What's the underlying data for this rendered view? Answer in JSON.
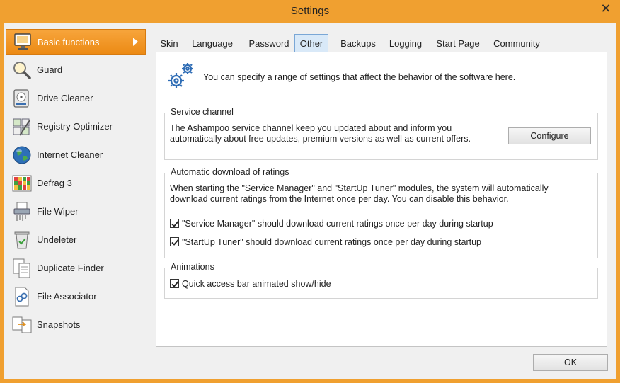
{
  "window": {
    "title": "Settings",
    "close_icon": "close-icon"
  },
  "sidebar": {
    "items": [
      {
        "label": "Basic functions",
        "icon": "monitor-settings-icon",
        "active": true
      },
      {
        "label": "Guard",
        "icon": "magnifier-icon"
      },
      {
        "label": "Drive Cleaner",
        "icon": "drive-cleaner-icon"
      },
      {
        "label": "Registry Optimizer",
        "icon": "registry-icon"
      },
      {
        "label": "Internet Cleaner",
        "icon": "globe-icon"
      },
      {
        "label": "Defrag 3",
        "icon": "defrag-grid-icon"
      },
      {
        "label": "File Wiper",
        "icon": "shredder-icon"
      },
      {
        "label": "Undeleter",
        "icon": "recycle-bin-icon"
      },
      {
        "label": "Duplicate Finder",
        "icon": "duplicate-docs-icon"
      },
      {
        "label": "File Associator",
        "icon": "file-link-icon"
      },
      {
        "label": "Snapshots",
        "icon": "snapshots-icon"
      }
    ]
  },
  "tabs": [
    {
      "label": "Skin"
    },
    {
      "label": "Language"
    },
    {
      "label": "Password"
    },
    {
      "label": "Other",
      "active": true
    },
    {
      "label": "Backups"
    },
    {
      "label": "Logging"
    },
    {
      "label": "Start Page"
    },
    {
      "label": "Community"
    }
  ],
  "intro": {
    "text": "You can specify a range of settings that affect the behavior of the software here.",
    "icon": "gears-icon"
  },
  "service_channel": {
    "title": "Service channel",
    "line1": "The Ashampoo service channel keep you updated about and inform you",
    "line2": "automatically about free updates, premium versions as well as current offers.",
    "button": "Configure"
  },
  "ratings": {
    "title": "Automatic download of ratings",
    "line1": "When starting the \"Service Manager\" and \"StartUp Tuner\" modules, the system will automatically",
    "line2": "download current ratings from the Internet once per day. You can disable this behavior.",
    "checks": [
      {
        "label": "\"Service Manager\" should download current ratings once per day during startup",
        "checked": true
      },
      {
        "label": "\"StartUp Tuner\" should download current ratings once per day during startup",
        "checked": true
      }
    ]
  },
  "animations": {
    "title": "Animations",
    "checks": [
      {
        "label": "Quick access bar animated show/hide",
        "checked": true
      }
    ]
  },
  "footer": {
    "ok_label": "OK"
  },
  "colors": {
    "accent": "#f0a030",
    "active_tab": "#d9e9f8"
  }
}
